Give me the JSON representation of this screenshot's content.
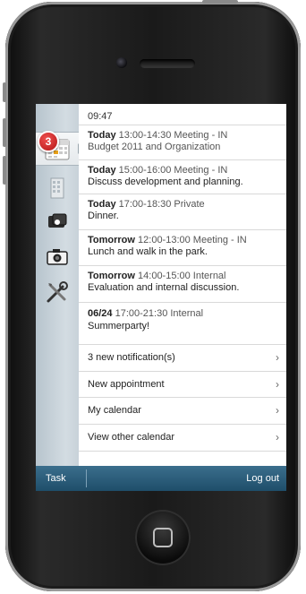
{
  "device": {
    "type": "phone-frame"
  },
  "status": {
    "time": "09:47"
  },
  "sidebar": {
    "badge_count": "3",
    "icons": [
      "calendar-icon",
      "building-icon",
      "photo-card-icon",
      "camera-icon",
      "tools-icon"
    ]
  },
  "events": [
    {
      "day": "Today",
      "head": "13:00-14:30 Meeting - IN",
      "desc": "Budget 2011 and Organization"
    },
    {
      "day": "Today",
      "head": "15:00-16:00 Meeting - IN",
      "desc": "Discuss development and planning."
    },
    {
      "day": "Today",
      "head": "17:00-18:30 Private",
      "desc": "Dinner."
    },
    {
      "day": "Tomorrow",
      "head": "12:00-13:00 Meeting - IN",
      "desc": "Lunch and walk in the park."
    },
    {
      "day": "Tomorrow",
      "head": "14:00-15:00 Internal",
      "desc": "Evaluation and internal discussion."
    },
    {
      "day": "06/24",
      "head": "17:00-21:30 Internal",
      "desc": "Summerparty!"
    }
  ],
  "menu": [
    {
      "label": "3 new notification(s)"
    },
    {
      "label": "New appointment"
    },
    {
      "label": "My calendar"
    },
    {
      "label": "View other calendar"
    }
  ],
  "bottom_bar": {
    "task": "Task",
    "logout": "Log out"
  },
  "colors": {
    "accent": "#1f4e6a",
    "badge": "#d42a2a"
  }
}
